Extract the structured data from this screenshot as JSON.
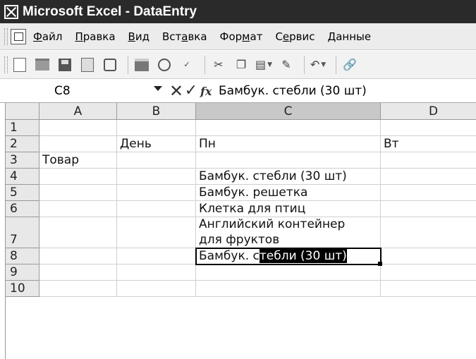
{
  "window": {
    "title": "Microsoft Excel - DataEntry"
  },
  "menu": [
    {
      "pre": "",
      "u": "Ф",
      "post": "айл"
    },
    {
      "pre": "",
      "u": "П",
      "post": "равка"
    },
    {
      "pre": "",
      "u": "В",
      "post": "ид"
    },
    {
      "pre": "Вст",
      "u": "а",
      "post": "вка"
    },
    {
      "pre": "Фор",
      "u": "м",
      "post": "ат"
    },
    {
      "pre": "С",
      "u": "е",
      "post": "рвис"
    },
    {
      "pre": "",
      "u": "Д",
      "post": "анные"
    }
  ],
  "toolbar_icons": [
    "new-icon",
    "open-icon",
    "save-icon",
    "permission-icon",
    "email-icon",
    "print-icon",
    "print-preview-icon",
    "spelling-icon",
    "cut-icon",
    "copy-icon",
    "paste-icon",
    "format-painter-icon",
    "undo-icon",
    "hyperlink-icon"
  ],
  "formula_bar": {
    "name_box": "C8",
    "fx": "fx",
    "content": "Бамбук. стебли (30 шт)"
  },
  "grid": {
    "columns": [
      "A",
      "B",
      "C",
      "D"
    ],
    "rows": [
      "1",
      "2",
      "3",
      "4",
      "5",
      "6",
      "7",
      "8",
      "9",
      "10"
    ],
    "cells": {
      "B2": "День",
      "C2": "Пн",
      "D2": "Вт",
      "A3": "Товар",
      "C4": "Бамбук. стебли (30 шт)",
      "C5": "Бамбук. решетка",
      "C6": "Клетка для птиц",
      "C7_line1": "Английский контейнер",
      "C7_line2": "для фруктов",
      "C8_plain": "Бамбук. с",
      "C8_selected": "тебли (30 шт)"
    },
    "active_cell": "C8",
    "selected_column": "C"
  }
}
